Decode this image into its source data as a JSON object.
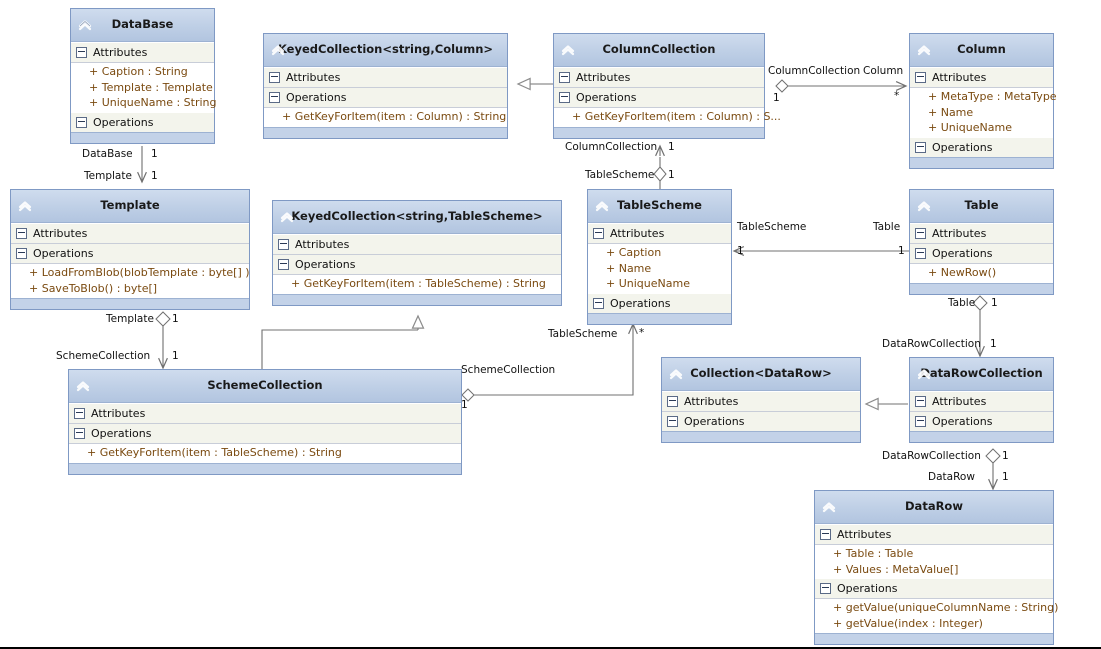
{
  "diagram": {
    "type": "uml-class-diagram",
    "icon": "collapse-chevron-icon",
    "compartment_labels": {
      "attributes": "Attributes",
      "operations": "Operations"
    },
    "colors": {
      "header_gradient_top": "#cfdcee",
      "header_gradient_bottom": "#b2c5e0",
      "box_border": "#7f99c4",
      "compartment_bg": "#f3f4ec",
      "member_text": "#7a4a10",
      "line": "#707070",
      "canvas_bg": "#ffffff"
    }
  },
  "classes": [
    {
      "id": "database",
      "name": "DataBase",
      "attributes": [
        "+ Caption : String",
        "+ Template : Template",
        "+ UniqueName : String"
      ],
      "operations": []
    },
    {
      "id": "keyedcollection_column",
      "name": "KeyedCollection<string,Column>",
      "attributes": [],
      "operations": [
        "+ GetKeyForItem(item : Column) : String"
      ]
    },
    {
      "id": "columncollection",
      "name": "ColumnCollection",
      "attributes": [],
      "operations": [
        "+ GetKeyForItem(item : Column) : S..."
      ]
    },
    {
      "id": "column",
      "name": "Column",
      "attributes": [
        "+ MetaType : MetaType",
        "+ Name",
        "+ UniqueName"
      ],
      "operations": []
    },
    {
      "id": "template",
      "name": "Template",
      "attributes": [],
      "operations": [
        "+ LoadFromBlob(blobTemplate : byte[] )",
        "+ SaveToBlob() : byte[]"
      ]
    },
    {
      "id": "keyedcollection_tablescheme",
      "name": "KeyedCollection<string,TableScheme>",
      "attributes": [],
      "operations": [
        "+ GetKeyForItem(item : TableScheme) : String"
      ]
    },
    {
      "id": "tablescheme",
      "name": "TableScheme",
      "attributes": [
        "+ Caption",
        "+ Name",
        "+ UniqueName"
      ],
      "operations": []
    },
    {
      "id": "table",
      "name": "Table",
      "attributes": [],
      "operations": [
        "+ NewRow()"
      ]
    },
    {
      "id": "schemecollection",
      "name": "SchemeCollection",
      "attributes": [],
      "operations": [
        "+ GetKeyForItem(item : TableScheme) : String"
      ]
    },
    {
      "id": "collection_datarow",
      "name": "Collection<DataRow>",
      "attributes": [],
      "operations": []
    },
    {
      "id": "datarowcollection",
      "name": "DataRowCollection",
      "attributes": [],
      "operations": []
    },
    {
      "id": "datarow",
      "name": "DataRow",
      "attributes": [
        "+ Table : Table",
        "+ Values : MetaValue[]"
      ],
      "operations": [
        "+ getValue(uniqueColumnName : String)",
        "+ getValue(index : Integer)"
      ]
    }
  ],
  "edge_labels": {
    "database_role": "DataBase",
    "database_mult": "1",
    "template_role_to_db": "Template",
    "template_mult_to_db": "1",
    "template_role_to_scheme": "Template",
    "template_mult_to_scheme": "1",
    "schemecollection_role": "SchemeCollection",
    "schemecollection_mult": "1",
    "columncollection_role_right": "ColumnCollection",
    "columncollection_mult_right": "1",
    "column_role": "Column",
    "column_mult": "*",
    "columncollection_role_down": "ColumnCollection",
    "columncollection_mult_down": "1",
    "tablescheme_role_up": "TableScheme",
    "tablescheme_mult_up": "1",
    "tablescheme_role_right": "TableScheme",
    "tablescheme_mult_right": "1",
    "table_role": "Table",
    "table_mult": "1",
    "tablescheme_role_down": "TableScheme",
    "tablescheme_mult_down": "*",
    "schemecollection_role_right": "SchemeCollection",
    "schemecollection_mult_right": "1",
    "table_role_down": "Table",
    "table_mult_down": "1",
    "datarowcollection_role_up": "DataRowCollection",
    "datarowcollection_mult_up": "1",
    "datarowcollection_role_down": "DataRowCollection",
    "datarowcollection_mult_down": "1",
    "datarow_role": "DataRow",
    "datarow_mult": "1"
  }
}
